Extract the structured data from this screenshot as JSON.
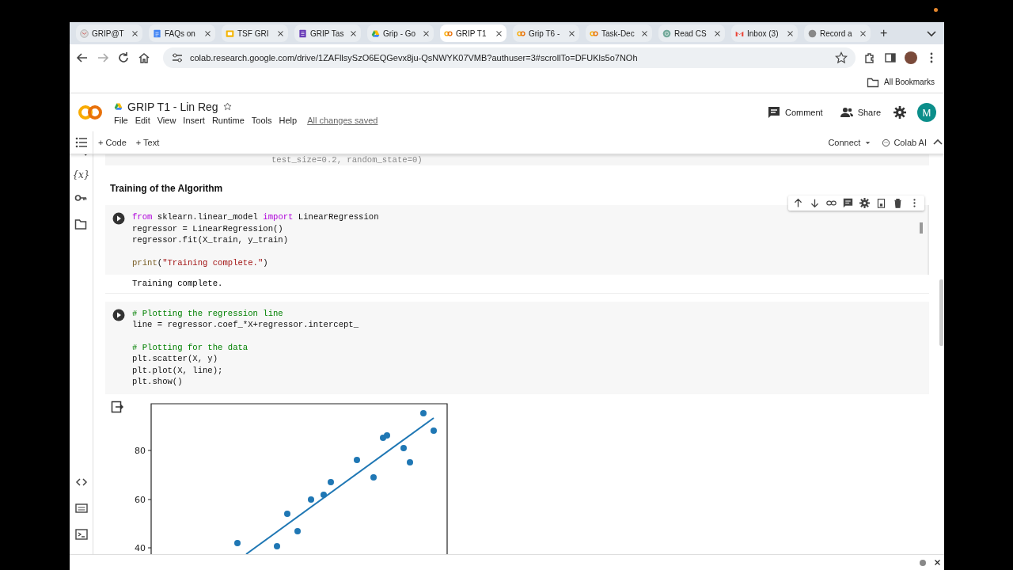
{
  "browser": {
    "tabs": [
      {
        "title": "GRIP@T",
        "kind": "mail",
        "selected": false
      },
      {
        "title": "FAQs on",
        "kind": "doc",
        "selected": false
      },
      {
        "title": "TSF GRI",
        "kind": "slide",
        "selected": false
      },
      {
        "title": "GRIP Tas",
        "kind": "form",
        "selected": false
      },
      {
        "title": "Grip - Go",
        "kind": "drive",
        "selected": false
      },
      {
        "title": "GRIP T1",
        "kind": "colab",
        "selected": true
      },
      {
        "title": "Grip T6 -",
        "kind": "colab",
        "selected": false
      },
      {
        "title": "Task-Dec",
        "kind": "colab",
        "selected": false
      },
      {
        "title": "Read CS",
        "kind": "chat",
        "selected": false
      },
      {
        "title": "Inbox (3)",
        "kind": "gmail",
        "selected": false
      },
      {
        "title": "Record a",
        "kind": "apple",
        "selected": false
      }
    ],
    "new_tab": "+",
    "url": "colab.research.google.com/drive/1ZAFllsySzO6EQGevx8ju-QsNWYK07VMB?authuser=3#scrollTo=DFUKls5o7NOh",
    "bookmarks": "All Bookmarks"
  },
  "notebook": {
    "title": "GRIP T1 - Lin Reg",
    "menu": [
      "File",
      "Edit",
      "View",
      "Insert",
      "Runtime",
      "Tools",
      "Help"
    ],
    "save_status": "All changes saved",
    "comment": "Comment",
    "share": "Share",
    "avatar": "M",
    "toolbar": {
      "add_code": "+ Code",
      "add_text": "+ Text",
      "connect": "Connect",
      "colab_ai": "Colab AI"
    }
  },
  "sidebar": {
    "variables": "{x}"
  },
  "cells": [
    {
      "kind": "partial",
      "lines": [
        {
          "kind": "code",
          "tokens": [
            {
              "text": "test_size=0.2, random_state=0)",
              "kind": "plain"
            }
          ]
        }
      ]
    },
    {
      "kind": "text",
      "heading": "Training of the Algorithm"
    },
    {
      "kind": "code",
      "focused": true,
      "lines": [
        {
          "kind": "code",
          "tokens": [
            {
              "text": "from",
              "kind": "keyword"
            },
            {
              "text": " sklearn.linear_model ",
              "kind": "plain"
            },
            {
              "text": "import",
              "kind": "keyword"
            },
            {
              "text": " LinearRegression",
              "kind": "plain"
            }
          ]
        },
        {
          "kind": "code",
          "tokens": [
            {
              "text": "regressor = LinearRegression()",
              "kind": "plain"
            }
          ]
        },
        {
          "kind": "code",
          "tokens": [
            {
              "text": "regressor.fit(X_train, y_train)",
              "kind": "plain"
            }
          ]
        },
        {
          "kind": "blank"
        },
        {
          "kind": "code",
          "tokens": [
            {
              "text": "print",
              "kind": "function"
            },
            {
              "text": "(",
              "kind": "plain"
            },
            {
              "text": "\"Training complete.\"",
              "kind": "string"
            },
            {
              "text": ")",
              "kind": "plain"
            }
          ]
        }
      ],
      "output": "Training complete."
    },
    {
      "kind": "code",
      "focused": false,
      "lines": [
        {
          "kind": "code",
          "tokens": [
            {
              "text": "# Plotting the regression line",
              "kind": "comment"
            }
          ]
        },
        {
          "kind": "code",
          "tokens": [
            {
              "text": "line = regressor.coef_*X+regressor.intercept_",
              "kind": "plain"
            }
          ]
        },
        {
          "kind": "blank"
        },
        {
          "kind": "code",
          "tokens": [
            {
              "text": "# Plotting for the data",
              "kind": "comment"
            }
          ]
        },
        {
          "kind": "code",
          "tokens": [
            {
              "text": "plt.scatter(X, y)",
              "kind": "plain"
            }
          ]
        },
        {
          "kind": "code",
          "tokens": [
            {
              "text": "plt.plot(X, line);",
              "kind": "plain"
            }
          ]
        },
        {
          "kind": "code",
          "tokens": [
            {
              "text": "plt.show()",
              "kind": "plain"
            }
          ]
        }
      ],
      "plot": {
        "kind": "scatter-with-line",
        "y_tick_labels": [
          "80",
          "60",
          "40"
        ]
      }
    }
  ]
}
